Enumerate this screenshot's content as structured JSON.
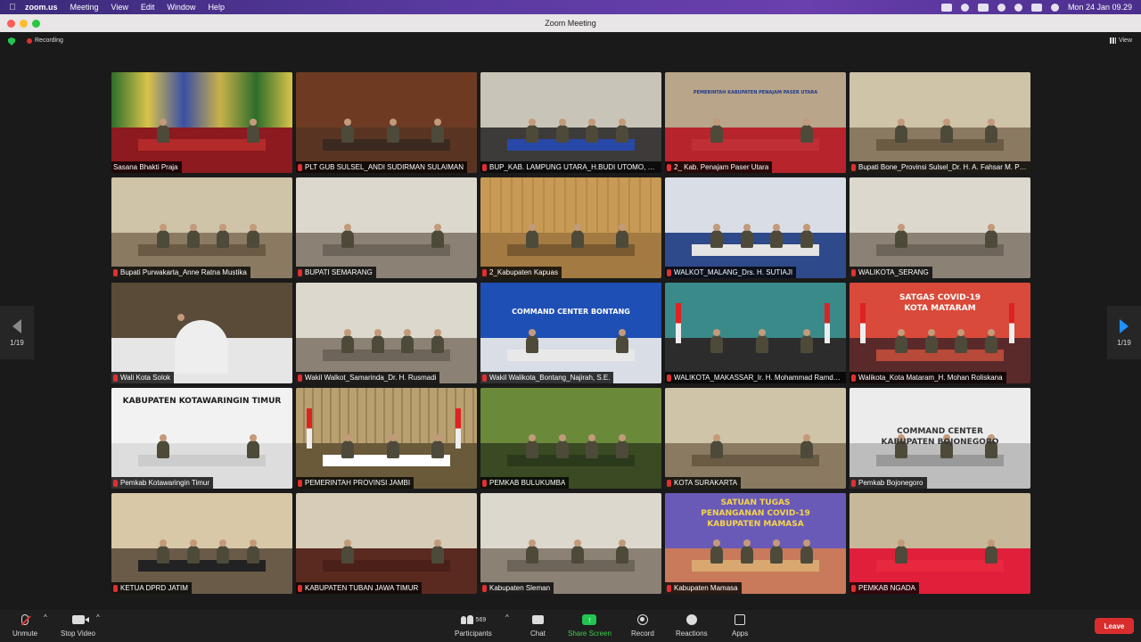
{
  "menubar": {
    "app_name": "zoom.us",
    "menus": [
      "Meeting",
      "View",
      "Edit",
      "Window",
      "Help"
    ],
    "clock": "Mon 24 Jan  09.29"
  },
  "window": {
    "title": "Zoom Meeting"
  },
  "meeting": {
    "recording_label": "Recording",
    "view_label": "View",
    "page_left": "1/19",
    "page_right": "1/19"
  },
  "participants": [
    {
      "name": "Sasana Bhakti Praja",
      "scene": "flags-hall",
      "active": true,
      "muted": false
    },
    {
      "name": "PLT GUB SULSEL_ANDI SUDIRMAN SULAIMAN",
      "scene": "office-red",
      "active": false,
      "muted": true
    },
    {
      "name": "BUP_KAB. LAMPUNG UTARA_H.BUDI UTOMO, S.E., M.M",
      "scene": "hall-blue-chairs",
      "active": false,
      "muted": true
    },
    {
      "name": "2_ Kab. Penajam Paser Utara",
      "scene": "hall-red",
      "active": false,
      "muted": true
    },
    {
      "name": "Bupati Bone_Provinsi Sulsel_Dr. H. A. Fahsar M. Padjalangi",
      "scene": "hall-beige",
      "active": false,
      "muted": true
    },
    {
      "name": "Bupati Purwakarta_Anne Ratna Mustika",
      "scene": "hall-beige",
      "active": false,
      "muted": true
    },
    {
      "name": "BUPATI SEMARANG",
      "scene": "hall-light",
      "active": false,
      "muted": true
    },
    {
      "name": "2_Kabupaten Kapuas",
      "scene": "wood-wall",
      "active": false,
      "muted": true
    },
    {
      "name": "WALKOT_MALANG_Drs. H. SUTIAJI",
      "scene": "hall-blue",
      "active": false,
      "muted": true
    },
    {
      "name": "WALIKOTA_SERANG",
      "scene": "hall-light",
      "active": false,
      "muted": true
    },
    {
      "name": "Wali Kota Solok",
      "scene": "closeup",
      "active": false,
      "muted": true
    },
    {
      "name": "Wakil Walkot_Samarinda_Dr. H. Rusmadi",
      "scene": "hall-light",
      "active": false,
      "muted": true
    },
    {
      "name": "Wakil Walikota_Bontang_Najirah, S.E.",
      "scene": "command-blue",
      "active": false,
      "muted": true
    },
    {
      "name": "WALIKOTA_MAKASSAR_Ir. H. Mohammad Ramdhan Pomanto",
      "scene": "teal-flags",
      "active": false,
      "muted": true
    },
    {
      "name": "Walikota_Kota Mataram_H. Mohan Roliskana",
      "scene": "satgas-red",
      "active": false,
      "muted": true
    },
    {
      "name": "Pemkab Kotawaringin Timur",
      "scene": "white-banner",
      "active": false,
      "muted": true
    },
    {
      "name": "PEMERINTAH PROVINSI JAMBI",
      "scene": "curtain",
      "active": false,
      "muted": true
    },
    {
      "name": "PEMKAB BULUKUMBA",
      "scene": "green-room",
      "active": false,
      "muted": true
    },
    {
      "name": "KOTA SURAKARTA",
      "scene": "hall-beige",
      "active": false,
      "muted": true
    },
    {
      "name": "Pemkab Bojonegoro",
      "scene": "command-white",
      "active": false,
      "muted": true
    },
    {
      "name": "KETUA DPRD JATIM",
      "scene": "office-chair",
      "active": false,
      "muted": true
    },
    {
      "name": "KABUPATEN TUBAN JAWA TIMUR",
      "scene": "hall-wood",
      "active": false,
      "muted": true
    },
    {
      "name": "Kabupaten Sleman",
      "scene": "hall-light",
      "active": false,
      "muted": true
    },
    {
      "name": "Kabupaten Mamasa",
      "scene": "satgas-purple",
      "active": false,
      "muted": true
    },
    {
      "name": "PEMKAB NGADA",
      "scene": "red-table",
      "active": false,
      "muted": true
    }
  ],
  "scene_text": {
    "penajam_banner": "PEMERINTAH KABUPATEN PENAJAM PASER UTARA",
    "bontang": "COMMAND CENTER BONTANG",
    "mataram_1": "SATGAS COVID-19",
    "mataram_2": "KOTA MATARAM",
    "kotim_1": "KABUPATEN KOTAWARINGIN TIMUR",
    "bojonegoro_1": "COMMAND CENTER",
    "bojonegoro_2": "KABUPATEN BOJONEGORO",
    "mamasa_1": "SATUAN TUGAS",
    "mamasa_2": "PENANGANAN COVID-19",
    "mamasa_3": "KABUPATEN MAMASA"
  },
  "toolbar": {
    "unmute": "Unmute",
    "stop_video": "Stop Video",
    "participants": "Participants",
    "participant_count": "569",
    "chat": "Chat",
    "share_screen": "Share Screen",
    "record": "Record",
    "reactions": "Reactions",
    "apps": "Apps",
    "leave": "Leave"
  },
  "colors": {
    "active_speaker": "#3fcf4a",
    "share_green": "#23c552",
    "leave_red": "#d92d2d"
  }
}
